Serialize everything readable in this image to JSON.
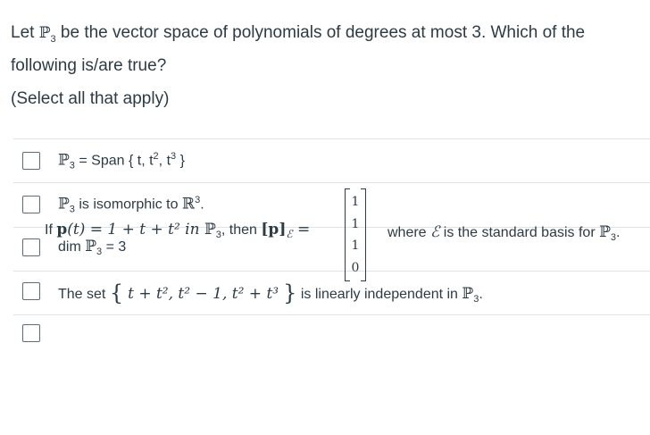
{
  "question": {
    "text_1": "Let ",
    "space_symbol": "ℙ",
    "space_sub": "3",
    "text_2": " be the vector space of polynomials of degrees at most 3.  Which of the following is/are true?"
  },
  "instruction": "(Select all that apply)",
  "options": [
    {
      "symbol": "ℙ",
      "sub": "3",
      "eq": " = Span { t, t",
      "sup2": "2",
      "comma": ", t",
      "sup3": "3",
      "close": " }"
    },
    {
      "symbol": "ℙ",
      "sub": "3",
      "text": " is isomorphic to ",
      "r_symbol": "ℝ",
      "r_sup": "3",
      "period": "."
    },
    {
      "prefix": "dim ",
      "symbol": "ℙ",
      "sub": "3",
      "suffix": " = 3"
    },
    {
      "prefix": "The set ",
      "lbrace": "{",
      "expr": "t + t², t² − 1, t² + t³",
      "rbrace": "}",
      "suffix": " is linearly independent in ",
      "symbol": "ℙ",
      "sub": "3",
      "period": "."
    },
    {
      "prefix": "If ",
      "p": "p",
      "poly": "(t) = 1 + t + t² in ",
      "symbol": "ℙ",
      "sub": "3",
      "then": ", then ",
      "bracket": "[p]",
      "basis_sub": "ℰ",
      "equals": " =",
      "vector": [
        "1",
        "1",
        "1",
        "0"
      ],
      "where": "where ",
      "where_basis": "ℰ",
      "where_text": " is the standard basis for ",
      "where_symbol": "ℙ",
      "where_sub": "3",
      "period": "."
    }
  ]
}
